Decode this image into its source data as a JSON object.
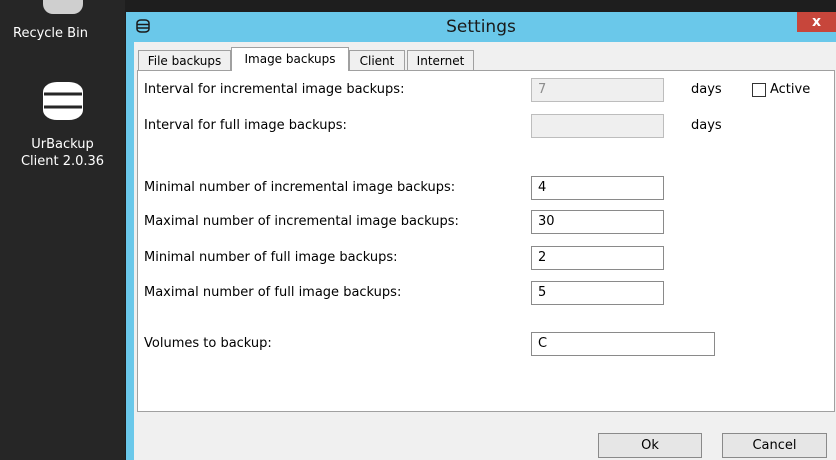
{
  "desktop": {
    "recycle_bin_label": "Recycle Bin",
    "urbackup_label_line1": "UrBackup",
    "urbackup_label_line2": "Client 2.0.36"
  },
  "window": {
    "title": "Settings",
    "close_glyph": "x"
  },
  "tabs": [
    {
      "label": "File backups",
      "active": false
    },
    {
      "label": "Image backups",
      "active": true
    },
    {
      "label": "Client",
      "active": false
    },
    {
      "label": "Internet",
      "active": false
    }
  ],
  "form": {
    "incr_interval_label": "Interval for incremental image backups:",
    "incr_interval_value": "7",
    "incr_interval_unit": "days",
    "active_label": "Active",
    "active_checked": false,
    "full_interval_label": "Interval for full image backups:",
    "full_interval_value": "",
    "full_interval_unit": "days",
    "min_incr_label": "Minimal number of incremental image backups:",
    "min_incr_value": "4",
    "max_incr_label": "Maximal number of incremental image backups:",
    "max_incr_value": "30",
    "min_full_label": "Minimal number of full image backups:",
    "min_full_value": "2",
    "max_full_label": "Maximal number of full image backups:",
    "max_full_value": "5",
    "volumes_label": "Volumes to backup:",
    "volumes_value": "C"
  },
  "buttons": {
    "ok": "Ok",
    "cancel": "Cancel"
  },
  "icons": {
    "recycle_bin": "recycle-bin-icon",
    "urbackup": "database-icon",
    "title": "database-icon"
  },
  "colors": {
    "titlebar": "#6ac8ea",
    "close": "#c7463b",
    "desktop": "#262626"
  }
}
